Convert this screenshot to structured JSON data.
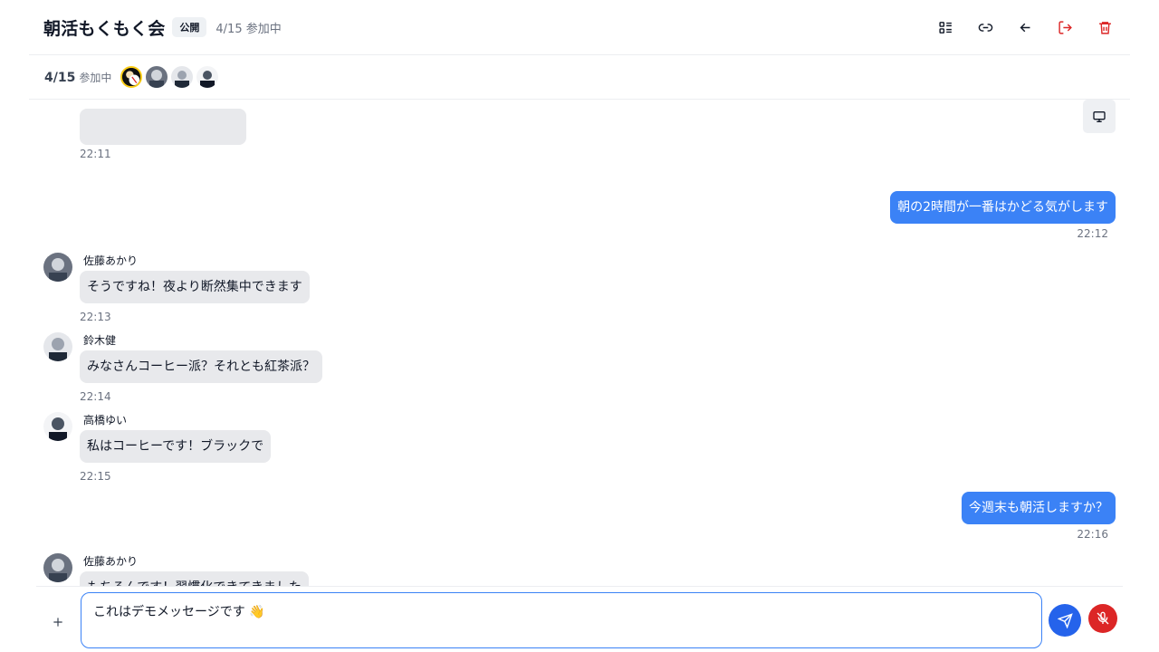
{
  "header": {
    "title": "朝活もくもく会",
    "badge": "公開",
    "count": "4/15",
    "count_label": "参加中",
    "icons": [
      "list-icon",
      "link-icon",
      "arrow-left-icon",
      "logout-icon",
      "trash-icon"
    ],
    "danger_color": "#dc2626"
  },
  "participants": {
    "count": "4/15",
    "count_label": "参加中"
  },
  "messages": [
    {
      "time": "22:11",
      "mine": false,
      "partial": true
    },
    {
      "text": "朝の2時間が一番はかどる気がします",
      "time": "22:12",
      "mine": true
    },
    {
      "name": "佐藤あかり",
      "text": "そうですね！夜より断然集中できます",
      "time": "22:13",
      "mine": false
    },
    {
      "name": "鈴木健",
      "text": "みなさんコーヒー派？それとも紅茶派？",
      "time": "22:14",
      "mine": false
    },
    {
      "name": "高橋ゆい",
      "text": "私はコーヒーです！ブラックで",
      "time": "22:15",
      "mine": false
    },
    {
      "text": "今週末も朝活しますか？",
      "time": "22:16",
      "mine": true
    },
    {
      "name": "佐藤あかり",
      "text": "もちろんです！習慣化できてきました",
      "time": "",
      "mine": false,
      "partial": true
    }
  ],
  "composer": {
    "value": "これはデモメッセージです 👋"
  },
  "colors": {
    "accent": "#3b82f6",
    "send": "#2563eb",
    "mic": "#dc2626"
  }
}
